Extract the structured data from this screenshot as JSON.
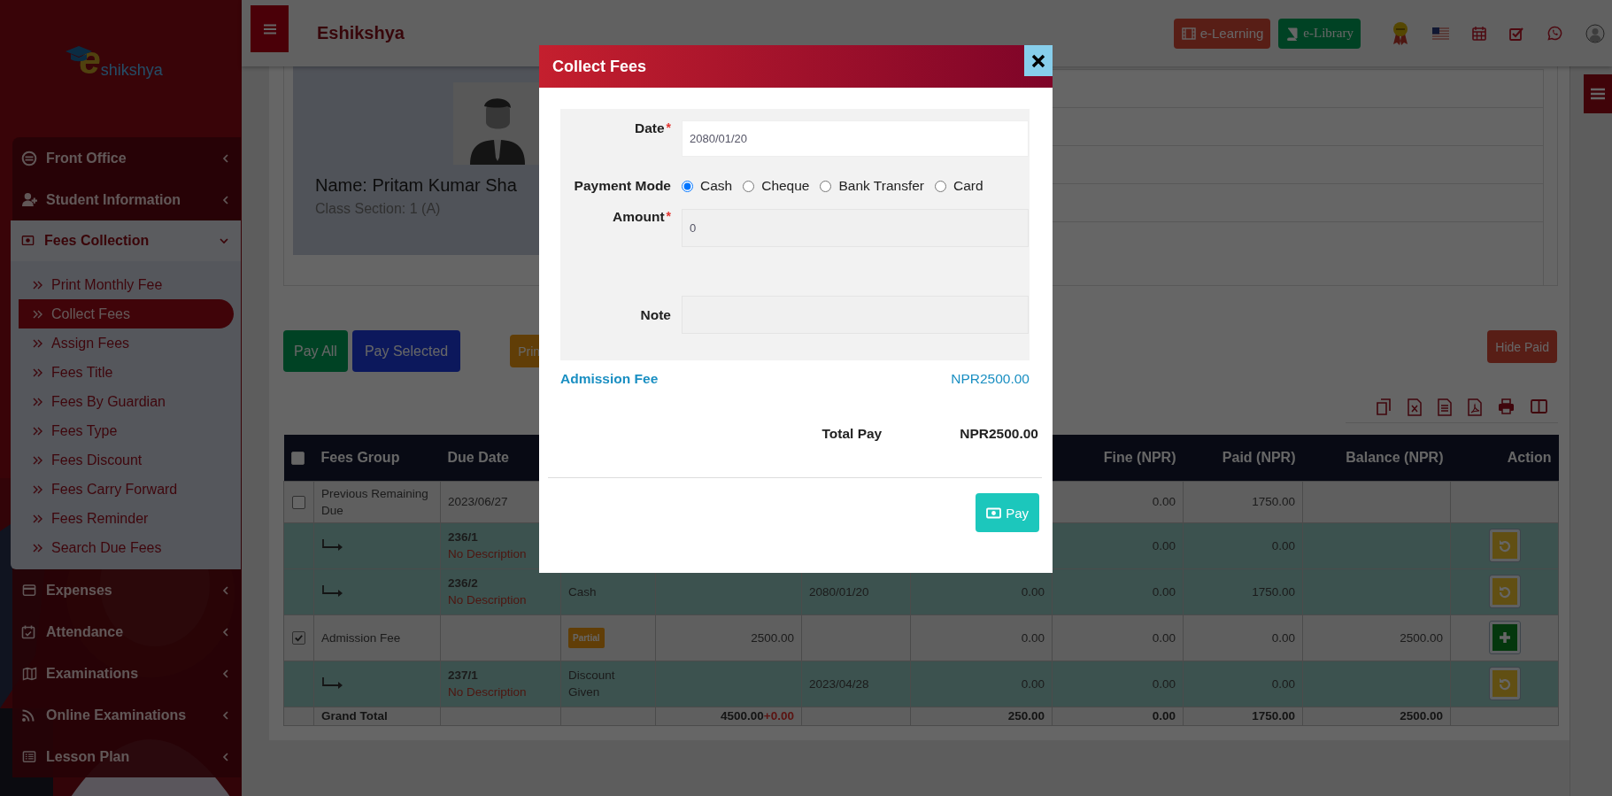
{
  "sidebar": {
    "logo": {
      "mark": "e",
      "text": "shikshya"
    },
    "menu": [
      {
        "label": "Front Office",
        "expanded": false
      },
      {
        "label": "Student Information",
        "expanded": false
      },
      {
        "label": "Fees Collection",
        "expanded": true,
        "children": [
          {
            "label": "Print Monthly Fee",
            "selected": false
          },
          {
            "label": "Collect Fees",
            "selected": true
          },
          {
            "label": "Assign Fees",
            "selected": false
          },
          {
            "label": "Fees Title",
            "selected": false
          },
          {
            "label": "Fees By Guardian",
            "selected": false
          },
          {
            "label": "Fees Type",
            "selected": false
          },
          {
            "label": "Fees Discount",
            "selected": false
          },
          {
            "label": "Fees Carry Forward",
            "selected": false
          },
          {
            "label": "Fees Reminder",
            "selected": false
          },
          {
            "label": "Search Due Fees",
            "selected": false
          }
        ]
      },
      {
        "label": "Expenses",
        "expanded": false
      },
      {
        "label": "Attendance",
        "expanded": false
      },
      {
        "label": "Examinations",
        "expanded": false
      },
      {
        "label": "Online Examinations",
        "expanded": false
      },
      {
        "label": "Lesson Plan",
        "expanded": false
      }
    ]
  },
  "topbar": {
    "title": "Eshikshya",
    "buttons": [
      {
        "label": "e-Learning",
        "kind": "learning"
      },
      {
        "label": "e-Library",
        "kind": "library"
      }
    ]
  },
  "profile": {
    "name": "Name: Pritam Kumar Sha",
    "class_section": "Class Section: 1 (A)"
  },
  "actions": [
    {
      "label": "Pay All",
      "kind": "pay_all"
    },
    {
      "label": "Pay Selected",
      "kind": "pay_selected"
    },
    {
      "label": "Prin",
      "kind": "print"
    },
    {
      "label": "Hide Paid",
      "kind": "hide_paid"
    }
  ],
  "table": {
    "select_all_checked": false,
    "columns": [
      "Fees Group",
      "Due Date",
      null,
      null,
      null,
      null,
      "Fine (NPR)",
      "Paid (NPR)",
      "Balance (NPR)",
      "Action"
    ],
    "rows": [
      {
        "kind": "fee",
        "checked": false,
        "fees_group": "Previous Remaining Due",
        "due_date": "2023/06/27",
        "fine": "0.00",
        "paid": "1750.00"
      },
      {
        "kind": "payment",
        "payment_id": "236/1",
        "description": "No Description",
        "fine": "0.00",
        "paid": "0.00",
        "action": {
          "kind": "revert"
        }
      },
      {
        "kind": "payment",
        "payment_id": "236/2",
        "description": "No Description",
        "column_3": "Cash",
        "column_5": "2080/01/20",
        "column_6": "0.00",
        "fine": "0.00",
        "paid": "1750.00",
        "action": {
          "kind": "revert"
        }
      },
      {
        "kind": "fee",
        "checked": true,
        "fees_group": "Admission Fee",
        "status_badge": "Partial",
        "column_4": "2500.00",
        "column_6": "0.00",
        "fine": "0.00",
        "paid": "0.00",
        "balance": "2500.00",
        "action": {
          "kind": "add"
        }
      },
      {
        "kind": "payment",
        "payment_id": "237/1",
        "description": "No Description",
        "column_3": "Discount Given",
        "column_5": "2023/04/28",
        "column_6": "0.00",
        "fine": "0.00",
        "paid": "0.00",
        "action": {
          "kind": "revert"
        }
      },
      {
        "kind": "total",
        "label": "Grand Total",
        "column_4": "4500.00",
        "column_4_adjustment": "+0.00",
        "column_6": "250.00",
        "fine": "0.00",
        "paid": "1750.00",
        "balance": "2500.00"
      }
    ]
  },
  "modal": {
    "title": "Collect Fees",
    "form": {
      "date": {
        "label": "Date",
        "required_mark": "*",
        "value": "2080/01/20",
        "disabled": false
      },
      "payment_mode": {
        "label": "Payment Mode",
        "options": [
          {
            "label": "Cash",
            "selected": true
          },
          {
            "label": "Cheque",
            "selected": false
          },
          {
            "label": "Bank Transfer",
            "selected": false
          },
          {
            "label": "Card",
            "selected": false
          }
        ]
      },
      "amount": {
        "label": "Amount",
        "required_mark": "*",
        "value": "0",
        "disabled": true
      },
      "note": {
        "label": "Note",
        "disabled": true
      }
    },
    "fee_line": {
      "name": "Admission Fee",
      "amount": "NPR2500.00"
    },
    "total": {
      "label": "Total Pay",
      "amount": "NPR2500.00"
    },
    "pay_button": "Pay"
  }
}
